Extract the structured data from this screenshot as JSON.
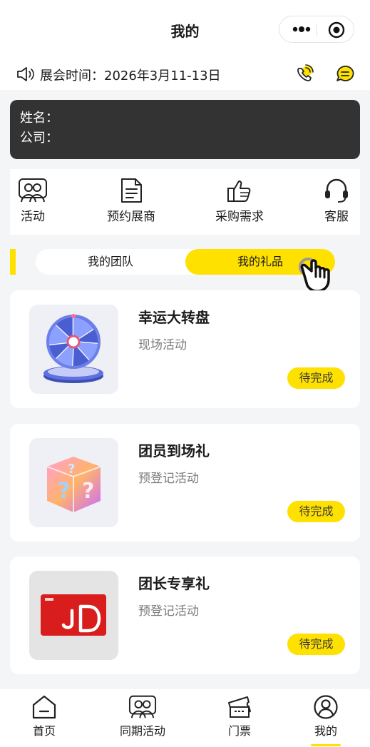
{
  "header": {
    "title": "我的"
  },
  "notice": {
    "text": "展会时间：2026年3月11-13日"
  },
  "user": {
    "name_label": "姓名：",
    "company_label": "公司："
  },
  "menu": [
    {
      "label": "活动",
      "icon": "people-icon"
    },
    {
      "label": "预约展商",
      "icon": "document-icon"
    },
    {
      "label": "采购需求",
      "icon": "thumbs-up-icon"
    },
    {
      "label": "客服",
      "icon": "headset-icon"
    }
  ],
  "tabs": {
    "team": "我的团队",
    "gifts": "我的礼品",
    "active": "gifts"
  },
  "gifts": [
    {
      "title": "幸运大转盘",
      "subtitle": "现场活动",
      "status": "待完成",
      "image": "prize-wheel"
    },
    {
      "title": "团员到场礼",
      "subtitle": "预登记活动",
      "status": "待完成",
      "image": "mystery-box"
    },
    {
      "title": "团长专享礼",
      "subtitle": "预登记活动",
      "status": "待完成",
      "image": "jd-gift-card"
    }
  ],
  "tabbar": [
    {
      "label": "首页",
      "icon": "home-icon"
    },
    {
      "label": "同期活动",
      "icon": "people-icon"
    },
    {
      "label": "门票",
      "icon": "ticket-icon"
    },
    {
      "label": "我的",
      "icon": "user-icon",
      "active": true
    }
  ],
  "colors": {
    "accent": "#ffe100",
    "card_dark": "#333333",
    "background": "#f4f5f7"
  }
}
